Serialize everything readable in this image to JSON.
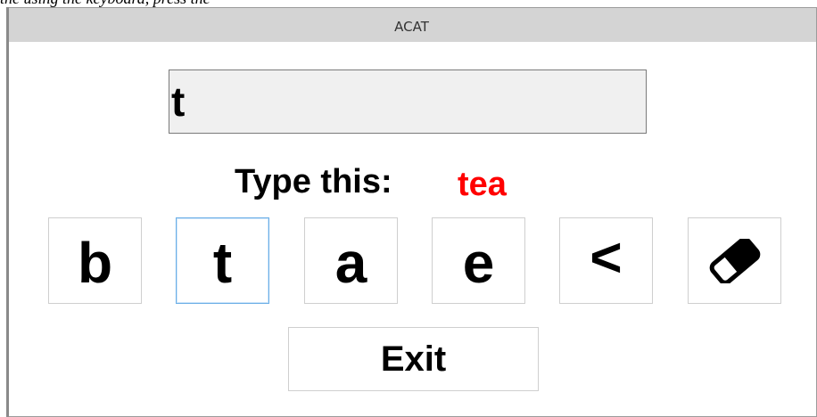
{
  "background_caption": "the using the keyboard, press the",
  "window": {
    "title": "ACAT"
  },
  "text_display": {
    "value": "t"
  },
  "prompt": {
    "label": "Type this:",
    "target": "tea"
  },
  "keys": [
    {
      "label": "b",
      "selected": false
    },
    {
      "label": "t",
      "selected": true
    },
    {
      "label": "a",
      "selected": false
    },
    {
      "label": "e",
      "selected": false
    },
    {
      "label": "<",
      "selected": false
    },
    {
      "icon": "eraser-icon",
      "selected": false
    }
  ],
  "exit_button": {
    "label": "Exit"
  },
  "colors": {
    "target_text": "#ff0000",
    "selected_key_border": "#6aaee6",
    "titlebar_bg": "#d4d4d4",
    "text_display_bg": "#f0f0f0"
  }
}
